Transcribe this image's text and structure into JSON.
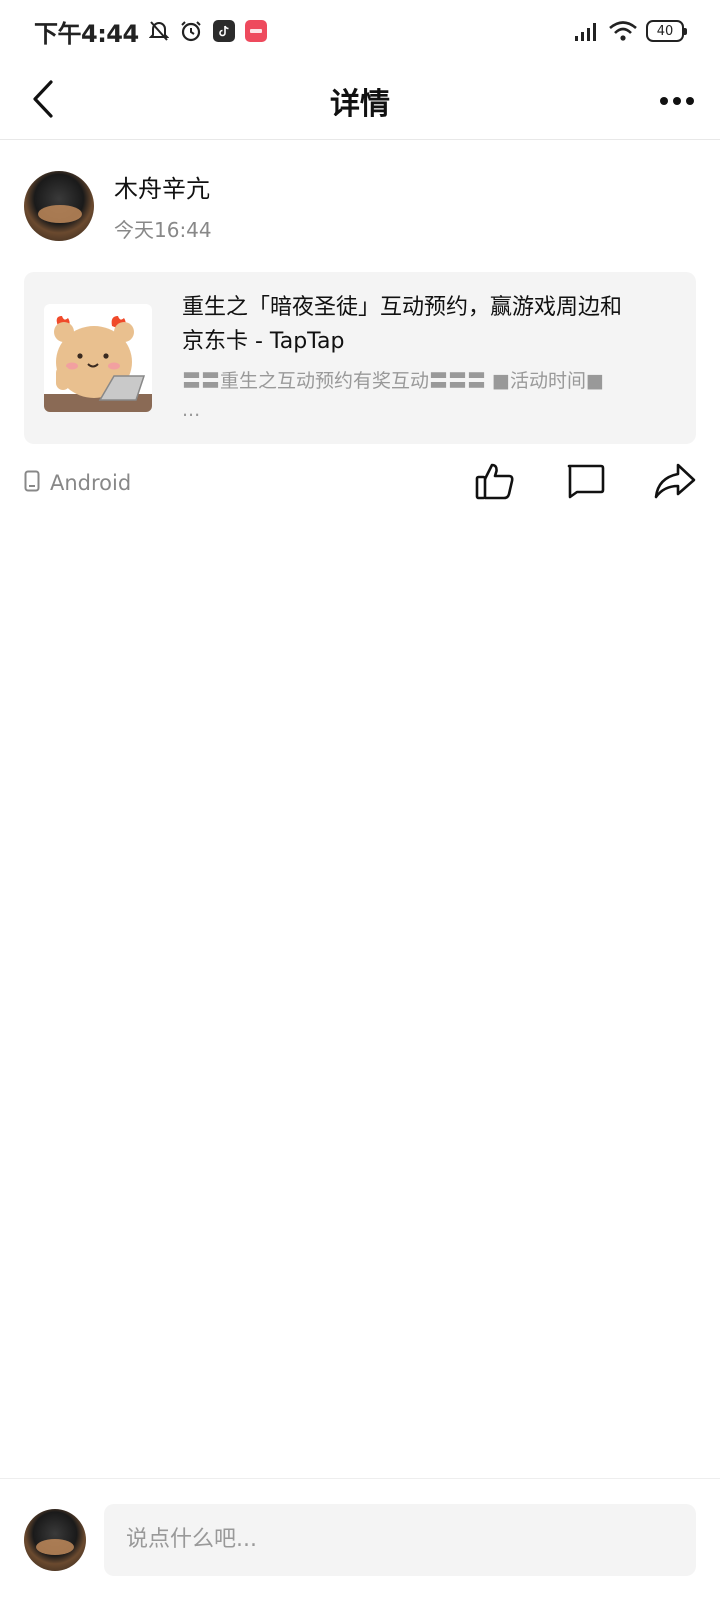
{
  "status_bar": {
    "time": "下午4:44",
    "battery": "40",
    "icons": [
      "mute-bell-icon",
      "alarm-icon",
      "tiktok-app-icon",
      "red-app-icon",
      "signal-icon",
      "wifi-icon",
      "battery-icon"
    ]
  },
  "nav": {
    "title": "详情",
    "back_icon": "back-chevron-icon",
    "more_icon": "more-dots-icon"
  },
  "author": {
    "name": "木舟辛亢",
    "time": "今天16:44"
  },
  "link_card": {
    "title": "重生之「暗夜圣徒」互动预约，赢游戏周边和京东卡 - TapTap",
    "description": "〓〓重生之互动预约有奖互动〓〓〓 ■活动时间■ ...",
    "thumbnail_icon": "bear-laptop-sticker"
  },
  "footer": {
    "device": "Android",
    "device_icon": "phone-icon",
    "like_icon": "thumbs-up-icon",
    "comment_icon": "comment-icon",
    "share_icon": "share-icon"
  },
  "comment_bar": {
    "placeholder": "说点什么吧..."
  },
  "colors": {
    "card_bg": "#f4f4f4",
    "muted_text": "#888888",
    "red_badge": "#ee4a5d"
  }
}
